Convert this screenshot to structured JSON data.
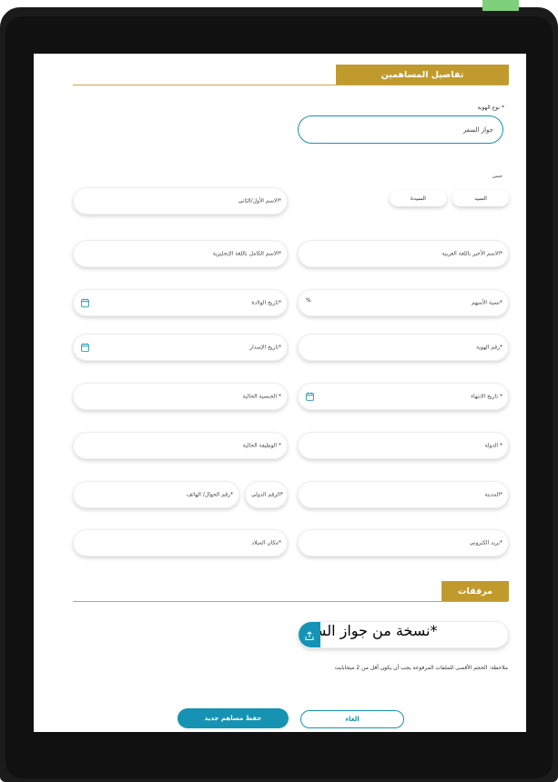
{
  "section_title": "تفاصيل المساهمين",
  "id_type": {
    "label": "نوع الهوية *",
    "value": "جواز السفر"
  },
  "gender": {
    "label": "جنس",
    "options": [
      "السيد",
      "السيدة"
    ]
  },
  "fields": {
    "first_name_ar": "الاسم الأول/الثاني*",
    "last_name_ar": "الاسم الأخير باللغة العربية*",
    "full_name_en": "الاسم الكامل باللغة الإنجليزية*",
    "share_percentage": "نسبة الأسهم*",
    "percent_symbol": "%",
    "birth_date": "تاريخ الولادة*",
    "id_number": "رقم الهوية*",
    "issue_date": "تاريخ الإصدار*",
    "expiry_date": "تاريخ الانتهاء *",
    "current_nationality": "الجنسية الحالية *",
    "country": "الدولة *",
    "professional_title": "الوظيفة الحالية *",
    "city": "المدينة*",
    "country_code": "الرقم الدولي*",
    "mobile_number": "رقم الجوال/ الهاتف*",
    "email": "بريد الكتروني*",
    "birth_place": "مكان الميلاد*"
  },
  "attachments": {
    "title": "مرفقات",
    "passport_copy": "نسخة من جواز السفر*",
    "note": "ملاحظة: الحجم الأقصى للملفات المرفوعة يجب أن يكون أقل من 2 ميجابايت"
  },
  "buttons": {
    "cancel": "الغاء",
    "save_new": "حفظ مساهم جديد"
  },
  "colors": {
    "gold": "#c19a2e",
    "teal": "#1693b3"
  }
}
